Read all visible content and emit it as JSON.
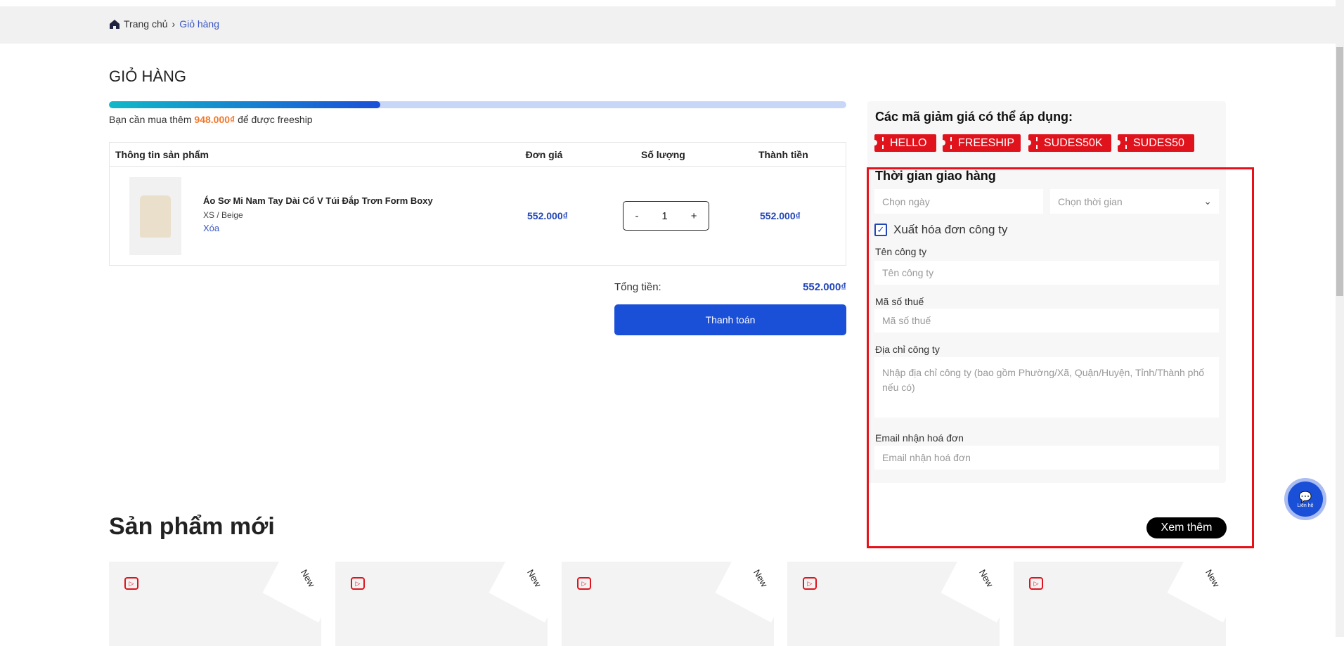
{
  "breadcrumb": {
    "home": "Trang chủ",
    "current": "Giỏ hàng"
  },
  "cart": {
    "title": "GIỎ HÀNG",
    "freeship_progress": 0.368,
    "freeship_prefix": "Bạn cần mua thêm ",
    "freeship_amount": "948.000₫",
    "freeship_suffix": " để được freeship",
    "headers": {
      "product": "Thông tin sản phẩm",
      "price": "Đơn giá",
      "qty": "Số lượng",
      "subtotal": "Thành tiền"
    },
    "items": [
      {
        "name": "Áo Sơ Mi Nam Tay Dài Cổ V Túi Đắp Trơn Form Boxy",
        "variant": "XS / Beige",
        "remove": "Xóa",
        "price": "552.000₫",
        "qty": "1",
        "subtotal": "552.000₫"
      }
    ],
    "minus": "-",
    "plus": "+",
    "total_label": "Tổng tiền:",
    "total_value": "552.000₫",
    "checkout": "Thanh toán"
  },
  "coupons": {
    "title": "Các mã giảm giá có thể áp dụng:",
    "codes": [
      "HELLO",
      "FREESHIP",
      "SUDES50K",
      "SUDES50"
    ]
  },
  "delivery": {
    "title": "Thời gian giao hàng",
    "date_placeholder": "Chọn ngày",
    "time_placeholder": "Chọn thời gian",
    "invoice_label": "Xuất hóa đơn công ty",
    "invoice_checked": true,
    "company_label": "Tên công ty",
    "company_placeholder": "Tên công ty",
    "tax_label": "Mã số thuế",
    "tax_placeholder": "Mã số thuế",
    "address_label": "Địa chỉ công ty",
    "address_placeholder": "Nhập địa chỉ công ty (bao gồm Phường/Xã, Quận/Huyện, Tỉnh/Thành phố nếu có)",
    "email_label": "Email nhận hoá đơn",
    "email_placeholder": "Email nhận hoá đơn"
  },
  "see_more": "Xem thêm",
  "chat": "Liên hệ",
  "new_products": {
    "title": "Sản phẩm mới",
    "badge": "New"
  }
}
